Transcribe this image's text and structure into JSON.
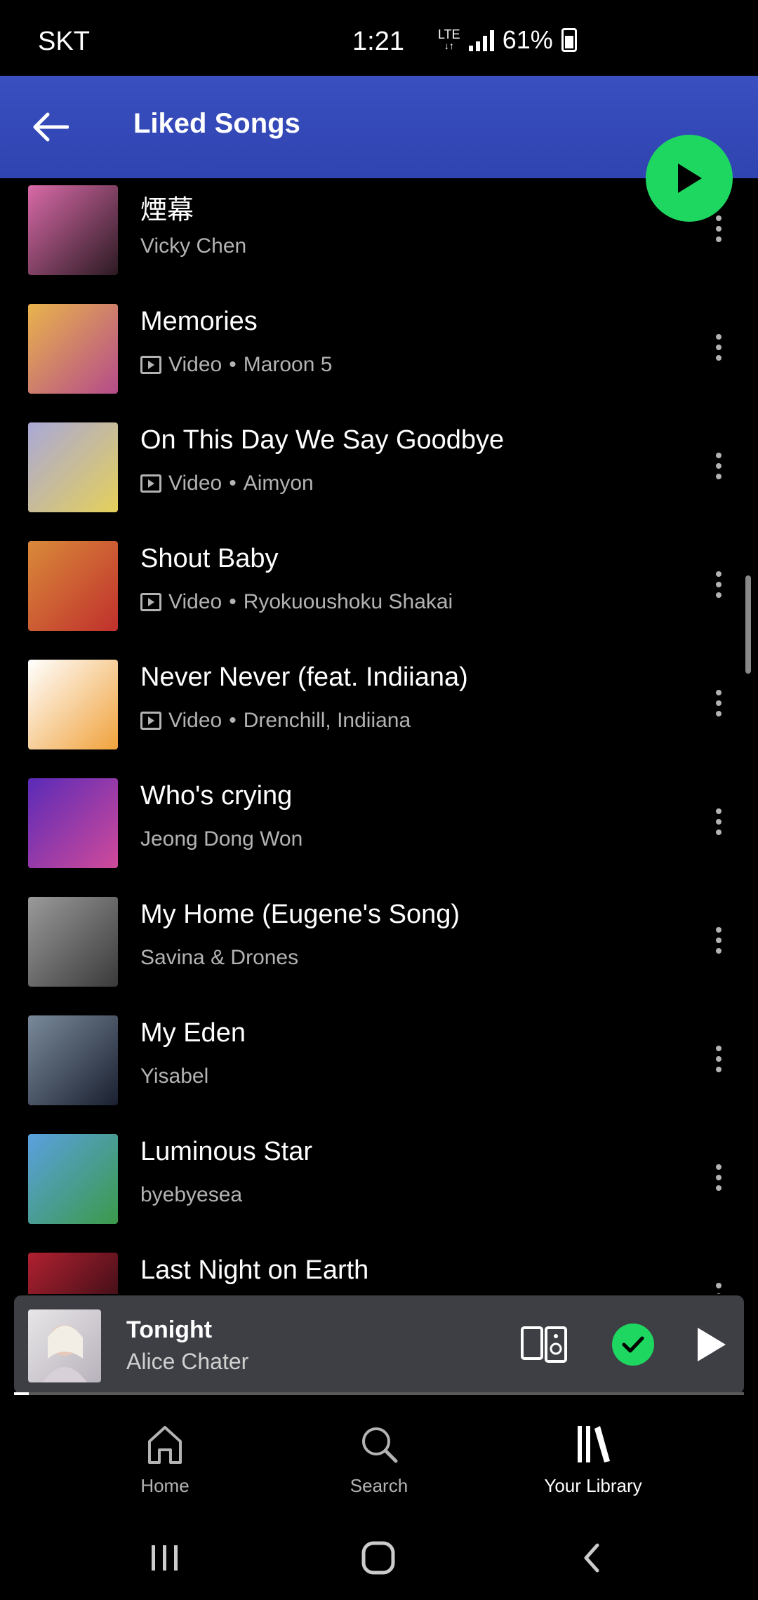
{
  "status_bar": {
    "carrier": "SKT",
    "time": "1:21",
    "network": "LTE",
    "battery": "61%"
  },
  "header": {
    "title": "Liked Songs"
  },
  "songs": [
    {
      "title": "煙幕",
      "is_video": false,
      "label": "",
      "artist": "Vicky Chen",
      "art_colors": [
        "#d96aa8",
        "#2b1a22"
      ]
    },
    {
      "title": "Memories",
      "is_video": true,
      "label": "Video",
      "artist": "Maroon 5",
      "art_colors": [
        "#e9b44c",
        "#b54b8a"
      ]
    },
    {
      "title": "On This Day We Say Goodbye",
      "is_video": true,
      "label": "Video",
      "artist": "Aimyon",
      "art_colors": [
        "#a9a8d8",
        "#e5d05a"
      ]
    },
    {
      "title": "Shout Baby",
      "is_video": true,
      "label": "Video",
      "artist": "Ryokuoushoku Shakai",
      "art_colors": [
        "#d98a3a",
        "#c0302c"
      ]
    },
    {
      "title": "Never Never (feat. Indiiana)",
      "is_video": true,
      "label": "Video",
      "artist": "Drenchill, Indiiana",
      "art_colors": [
        "#ffffff",
        "#f0a23c"
      ]
    },
    {
      "title": "Who's crying",
      "is_video": false,
      "label": "",
      "artist": "Jeong Dong Won",
      "art_colors": [
        "#5a2ab8",
        "#d04a9a"
      ]
    },
    {
      "title": "My Home (Eugene's Song)",
      "is_video": false,
      "label": "",
      "artist": "Savina & Drones",
      "art_colors": [
        "#9a9a9a",
        "#3a3a3a"
      ]
    },
    {
      "title": "My Eden",
      "is_video": false,
      "label": "",
      "artist": "Yisabel",
      "art_colors": [
        "#7a8a9a",
        "#1a2030"
      ]
    },
    {
      "title": "Luminous Star",
      "is_video": false,
      "label": "",
      "artist": "byebyesea",
      "art_colors": [
        "#5aa0e0",
        "#3a9a4a"
      ]
    },
    {
      "title": "Last Night on Earth",
      "is_video": false,
      "label": "",
      "artist": "",
      "art_colors": [
        "#b02030",
        "#200a10"
      ]
    }
  ],
  "mini_player": {
    "title": "Tonight",
    "artist": "Alice Chater",
    "progress": 0.02
  },
  "bottom_nav": [
    {
      "label": "Home",
      "icon": "home-icon",
      "active": false
    },
    {
      "label": "Search",
      "icon": "search-icon",
      "active": false
    },
    {
      "label": "Your Library",
      "icon": "library-icon",
      "active": true
    }
  ],
  "colors": {
    "accent": "#1ed760",
    "header": "#3a4fc0",
    "mini_player_bg": "#3e3f45"
  }
}
